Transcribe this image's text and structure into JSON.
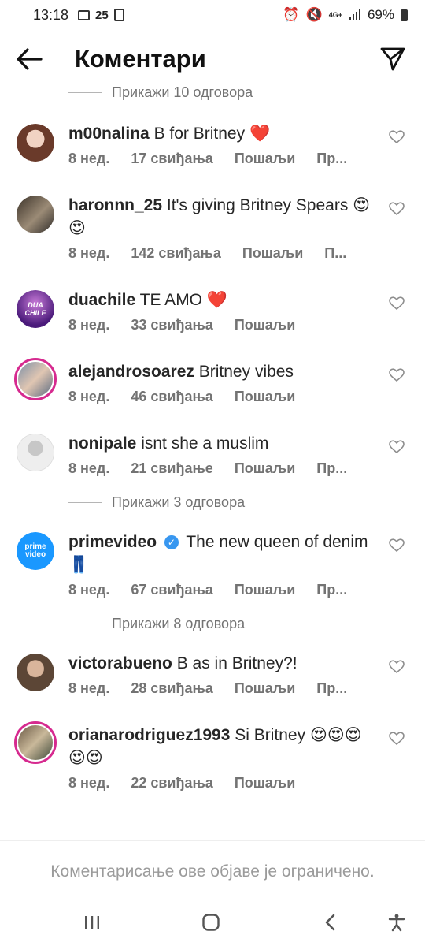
{
  "status": {
    "time": "13:18",
    "notif_count": "25",
    "network": "4G+",
    "battery": "69%"
  },
  "header": {
    "title": "Коментари"
  },
  "top_replies": "Прикажи 10 одговора",
  "comments": [
    {
      "username": "m00nalina",
      "text": "B for Britney ❤️",
      "age": "8 нед.",
      "likes": "17 свиђања",
      "send": "Пошаљи",
      "more": "Пр...",
      "avatar_color": "#c9a08a"
    },
    {
      "username": "haronnn_25",
      "text": "It's giving Britney Spears 😍😍",
      "age": "8 нед.",
      "likes": "142 свиђања",
      "send": "Пошаљи",
      "more": "П...",
      "avatar_color": "#6b5a4d"
    },
    {
      "username": "duachile",
      "text": "TE AMO ❤️",
      "age": "8 нед.",
      "likes": "33 свиђања",
      "send": "Пошаљи",
      "more": "",
      "avatar_color": "#5b2a8a"
    },
    {
      "username": "alejandrosoarez",
      "text": "Britney vibes",
      "age": "8 нед.",
      "likes": "46 свиђања",
      "send": "Пошаљи",
      "more": "",
      "avatar_color": "#8aa0b8"
    },
    {
      "username": "nonipale",
      "text": "isnt she a muslim",
      "age": "8 нед.",
      "likes": "21 свиђање",
      "send": "Пошаљи",
      "more": "Пр...",
      "avatar_color": "#dbdbdb"
    },
    {
      "username": "primevideo",
      "text": "The new queen of denim 👖",
      "age": "8 нед.",
      "likes": "67 свиђања",
      "send": "Пошаљи",
      "more": "Пр...",
      "avatar_color": "#1a98ff"
    },
    {
      "username": "victorabueno",
      "text": "B as in Britney?!",
      "age": "8 нед.",
      "likes": "28 свиђања",
      "send": "Пошаљи",
      "more": "Пр...",
      "avatar_color": "#8c7360"
    },
    {
      "username": "orianarodriguez1993",
      "text": "Si Britney 😍😍😍😍😍",
      "age": "8 нед.",
      "likes": "22 свиђања",
      "send": "Пошаљи",
      "more": "",
      "avatar_color": "#7a8c6e"
    }
  ],
  "replies_after_nonipale": "Прикажи 3 одговора",
  "replies_after_primevideo": "Прикажи 8 одговора",
  "avatar_labels": {
    "duachile": "DUA CHILE",
    "primevideo": "prime video"
  },
  "footer": {
    "restricted": "Коментарисање ове објаве је ограничено."
  }
}
